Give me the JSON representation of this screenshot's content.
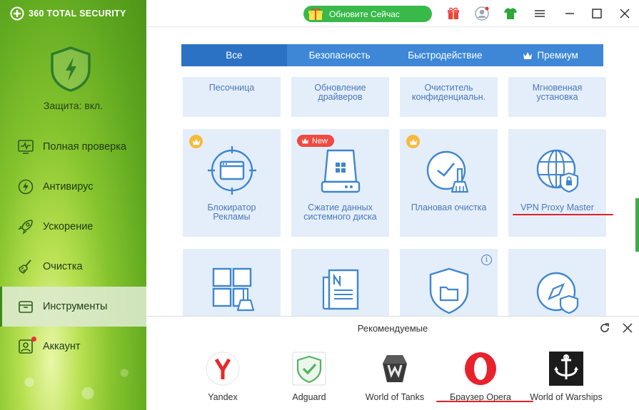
{
  "app": {
    "brand": "360 TOTAL SECURITY",
    "protection_status": "Защита: вкл."
  },
  "sidebar": {
    "items": [
      {
        "label": "Полная проверка",
        "icon": "monitor-pulse-icon"
      },
      {
        "label": "Антивирус",
        "icon": "bolt-circle-icon"
      },
      {
        "label": "Ускорение",
        "icon": "rocket-icon"
      },
      {
        "label": "Очистка",
        "icon": "broom-icon"
      },
      {
        "label": "Инструменты",
        "icon": "toolbox-icon",
        "active": true
      },
      {
        "label": "Аккаунт",
        "icon": "account-icon",
        "notification": true
      }
    ]
  },
  "titlebar": {
    "update_label": "Обновите Сейчас"
  },
  "tabs": [
    {
      "label": "Все",
      "active": true
    },
    {
      "label": "Безопасность"
    },
    {
      "label": "Быстродействие"
    },
    {
      "label": "Премиум",
      "icon": "crown-icon"
    }
  ],
  "tools": {
    "row1": [
      {
        "label": "Песочница"
      },
      {
        "label": "Обновление драйверов"
      },
      {
        "label": "Очиститель конфиденциальн."
      },
      {
        "label": "Мгновенная установка"
      }
    ],
    "row2": [
      {
        "label": "Блокиратор Рекламы",
        "badge": "premium"
      },
      {
        "label": "Сжатие данных системного диска",
        "badge": "new",
        "badge_text": "New"
      },
      {
        "label": "Плановая очистка",
        "badge": "premium"
      },
      {
        "label": "VPN Proxy Master"
      }
    ],
    "row3": [
      {
        "icon": "window-broom-icon"
      },
      {
        "icon": "news-icon"
      },
      {
        "icon": "shield-folder-icon",
        "badge": "info",
        "badge_text": "i"
      },
      {
        "icon": "compass-shield-icon"
      }
    ]
  },
  "recommended": {
    "title": "Рекомендуемые",
    "apps": [
      {
        "name": "Yandex"
      },
      {
        "name": "Adguard"
      },
      {
        "name": "World of Tanks"
      },
      {
        "name": "Браузер Opera"
      },
      {
        "name": "World of Warships"
      }
    ]
  },
  "colors": {
    "accent_blue": "#3d87d6",
    "tile_bg": "#e4eefa",
    "update_green": "#38b94a",
    "annotation_red": "#e0202a"
  }
}
